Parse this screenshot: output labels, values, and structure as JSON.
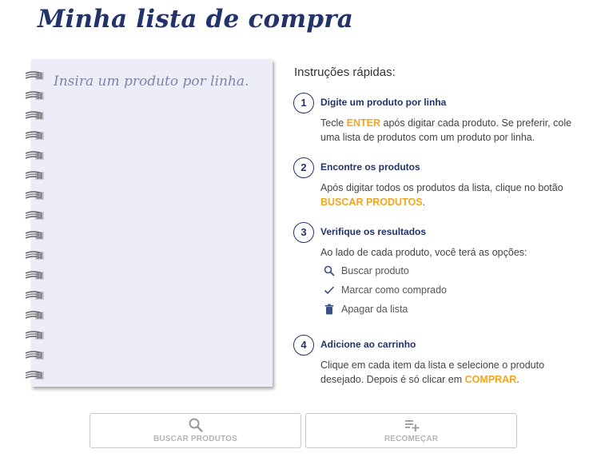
{
  "page": {
    "title": "Minha lista de compra"
  },
  "notebook": {
    "placeholder": "Insira um produto por linha."
  },
  "instructions": {
    "title": "Instruções rápidas:",
    "steps": [
      {
        "number": "1",
        "heading": "Digite um produto por linha",
        "body_pre": "Tecle ",
        "body_highlight": "ENTER",
        "body_post": " após digitar cada produto. Se preferir, cole uma lista de produtos com um produto por linha."
      },
      {
        "number": "2",
        "heading": "Encontre os produtos",
        "body_pre": "Após digitar todos os produtos da lista, clique no botão ",
        "body_highlight": "BUSCAR PRODUTOS",
        "body_post": "."
      },
      {
        "number": "3",
        "heading": "Verifique os resultados",
        "body": "Ao lado de cada produto, você terá as opções:",
        "options": [
          {
            "icon": "search-icon",
            "label": "Buscar produto"
          },
          {
            "icon": "check-icon",
            "label": "Marcar como comprado"
          },
          {
            "icon": "trash-icon",
            "label": "Apagar da lista"
          }
        ]
      },
      {
        "number": "4",
        "heading": "Adicione ao carrinho",
        "body_pre": "Clique em cada item da lista e selecione o produto desejado. Depois é só clicar em ",
        "body_highlight": "COMPRAR",
        "body_post": "."
      }
    ]
  },
  "buttons": {
    "search": {
      "label": "BUSCAR PRODUTOS",
      "icon": "search-icon"
    },
    "restart": {
      "label": "RECOMEÇAR",
      "icon": "playlist-add-icon"
    }
  },
  "colors": {
    "title": "#22336b",
    "highlight": "#f4a51c",
    "notebook_paper": "#ededf7"
  }
}
